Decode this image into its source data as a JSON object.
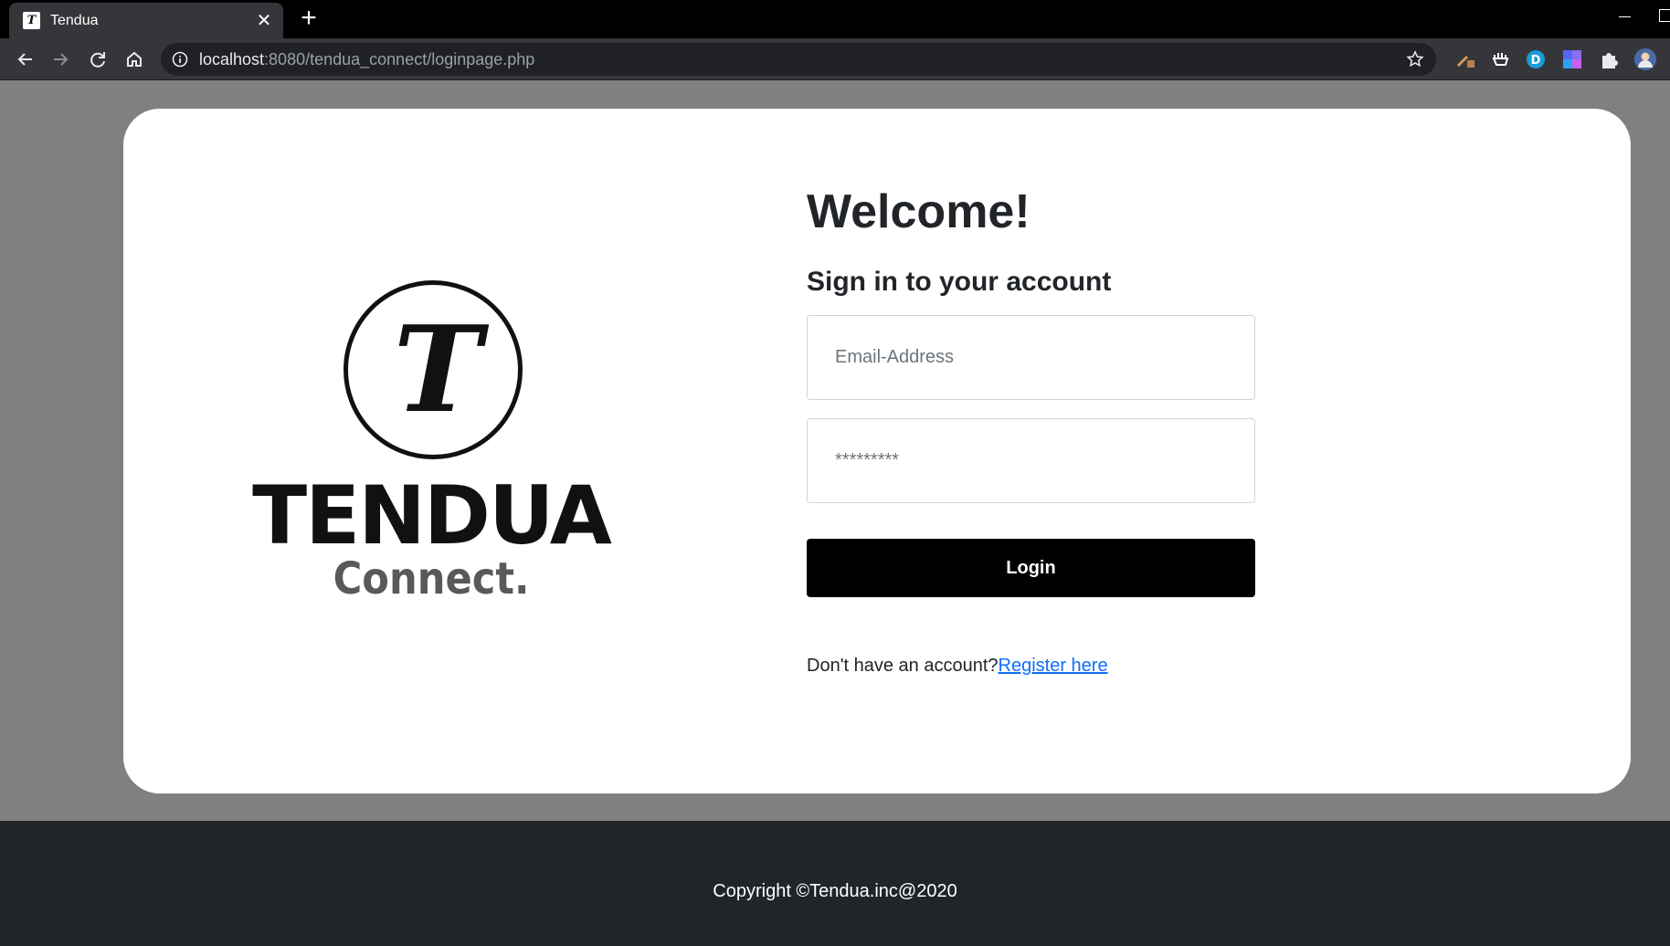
{
  "browser": {
    "tab_title": "Tendua",
    "url_host": "localhost",
    "url_rest": ":8080/tendua_connect/loginpage.php"
  },
  "logo": {
    "mark": "T",
    "wordmark": "TENDUA",
    "subtitle": "Connect."
  },
  "login": {
    "heading": "Welcome!",
    "subheading": "Sign in to your account",
    "email_placeholder": "Email-Address",
    "password_placeholder": "*********",
    "login_label": "Login",
    "register_prompt": "Don't have an account?",
    "register_link": "Register here"
  },
  "footer": {
    "copyright": "Copyright ©Tendua.inc@2020"
  },
  "colors": {
    "page_bg": "#808080",
    "card_bg": "#ffffff",
    "button_bg": "#000000",
    "link": "#0d6efd",
    "footer_bg": "#212529"
  }
}
